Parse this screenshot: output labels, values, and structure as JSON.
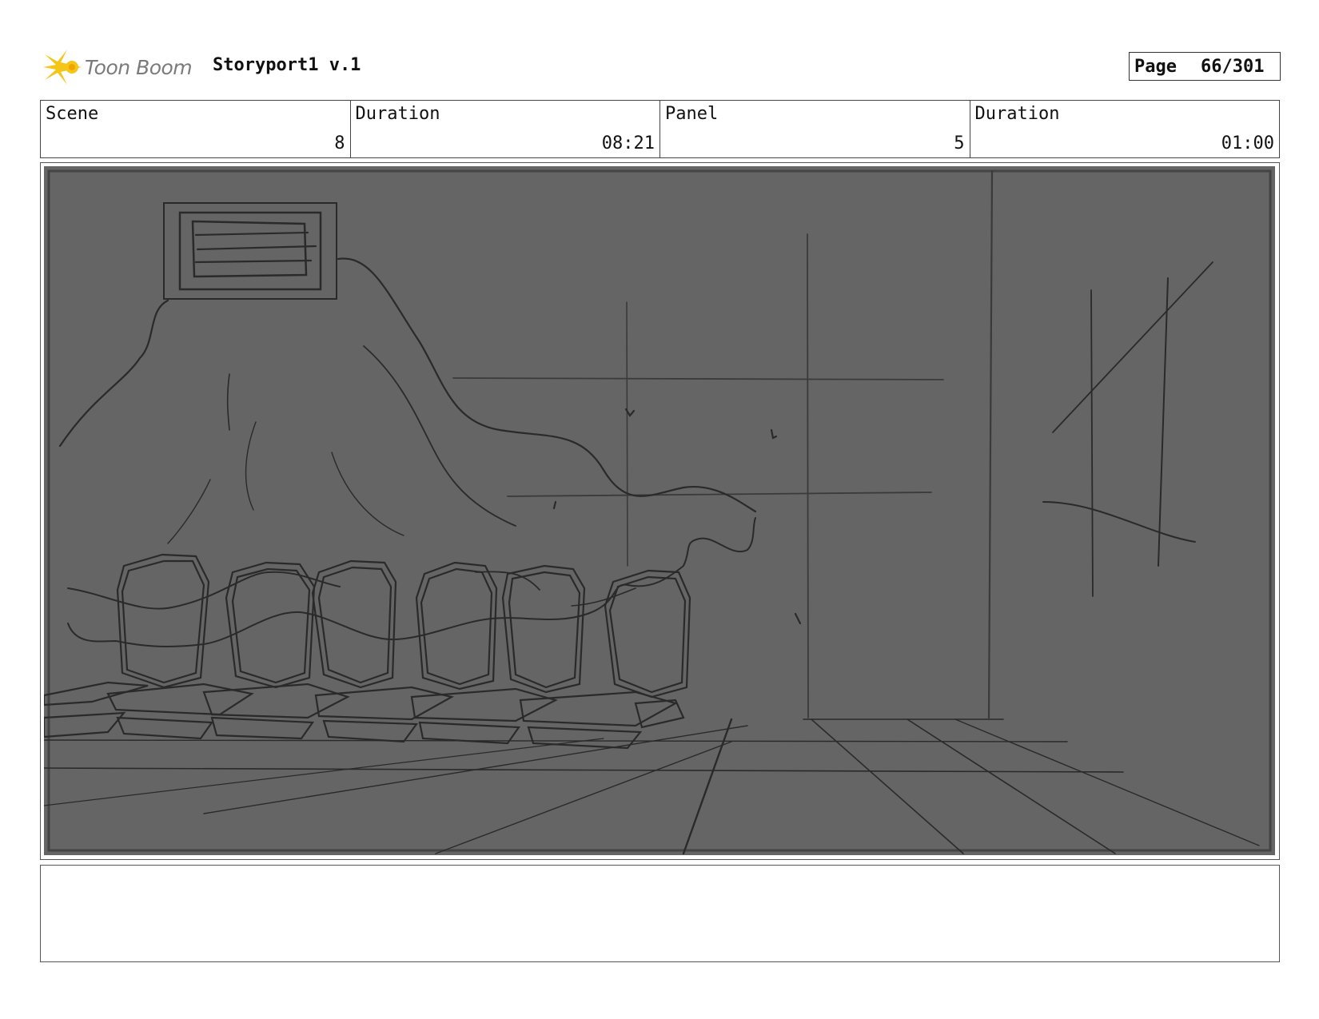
{
  "header": {
    "brand": "Toon Boom",
    "brand_color": "#7b7b7b",
    "logo_icon": "toon-boom-star-icon",
    "logo_color": "#f5c518",
    "title": "Storyport1 v.1",
    "page_label": "Page",
    "page_value": "66/301"
  },
  "info": {
    "scene_label": "Scene",
    "scene_value": "8",
    "scene_duration_label": "Duration",
    "scene_duration_value": "08:21",
    "panel_label": "Panel",
    "panel_value": "5",
    "panel_duration_label": "Duration",
    "panel_duration_value": "01:00"
  },
  "panel": {
    "background": "#656565",
    "line_color": "#2a2a2a"
  },
  "caption": {
    "text": ""
  }
}
